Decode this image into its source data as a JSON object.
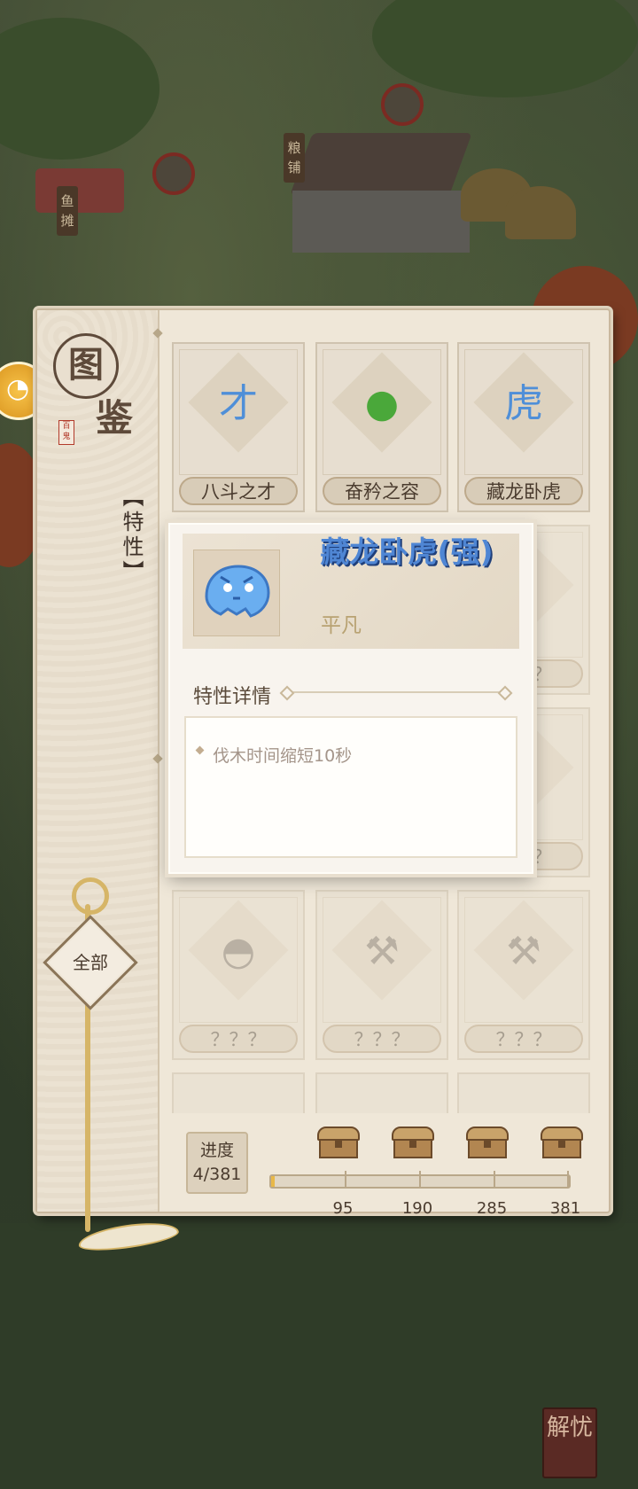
{
  "book": {
    "title_top": "图",
    "title_bottom": "鉴",
    "stamp": "百鬼",
    "side_tab": "【特性】",
    "filter_label": "全部"
  },
  "cards": [
    {
      "name": "八斗之才",
      "icon": "cai-character-icon",
      "glyph": "才",
      "color": "#4f8fd8",
      "locked": false
    },
    {
      "name": "奋矜之容",
      "icon": "green-figure-icon",
      "glyph": "●",
      "color": "#4aa83a",
      "locked": false
    },
    {
      "name": "藏龙卧虎",
      "icon": "tiger-head-icon",
      "glyph": "虎",
      "color": "#4f8fd8",
      "locked": false
    },
    {
      "name": "？？？",
      "icon": "unknown-icon",
      "glyph": "？",
      "locked": true
    },
    {
      "name": "？？？",
      "icon": "unknown-icon",
      "glyph": "？",
      "locked": true
    },
    {
      "name": "？？？",
      "icon": "unknown-icon",
      "glyph": "？",
      "locked": true
    },
    {
      "name": "？？？",
      "icon": "unknown-icon",
      "glyph": "？",
      "locked": true
    },
    {
      "name": "？？？",
      "icon": "unknown-icon",
      "glyph": "？",
      "locked": true
    },
    {
      "name": "？？？",
      "icon": "unknown-icon",
      "glyph": "？",
      "locked": true
    },
    {
      "name": "？？？",
      "icon": "helmet-icon",
      "glyph": "◓",
      "locked": true
    },
    {
      "name": "？？？",
      "icon": "axe-icon",
      "glyph": "⚒",
      "locked": true
    },
    {
      "name": "？？？",
      "icon": "axe-icon",
      "glyph": "⚒",
      "locked": true
    }
  ],
  "progress": {
    "label": "进度",
    "value": "4/381",
    "current": 4,
    "max": 381,
    "milestones": [
      "95",
      "190",
      "285",
      "381"
    ]
  },
  "popup": {
    "title": "藏龙卧虎(强)",
    "rarity": "平凡",
    "section": "特性详情",
    "description": "伐木时间缩短10秒"
  },
  "background": {
    "signs": [
      "鱼摊",
      "粮铺"
    ],
    "corner_button": "解忧"
  },
  "colors": {
    "accent_blue": "#4f86d4",
    "panel": "#efe7d8",
    "progress_fill": "#e8b848"
  }
}
